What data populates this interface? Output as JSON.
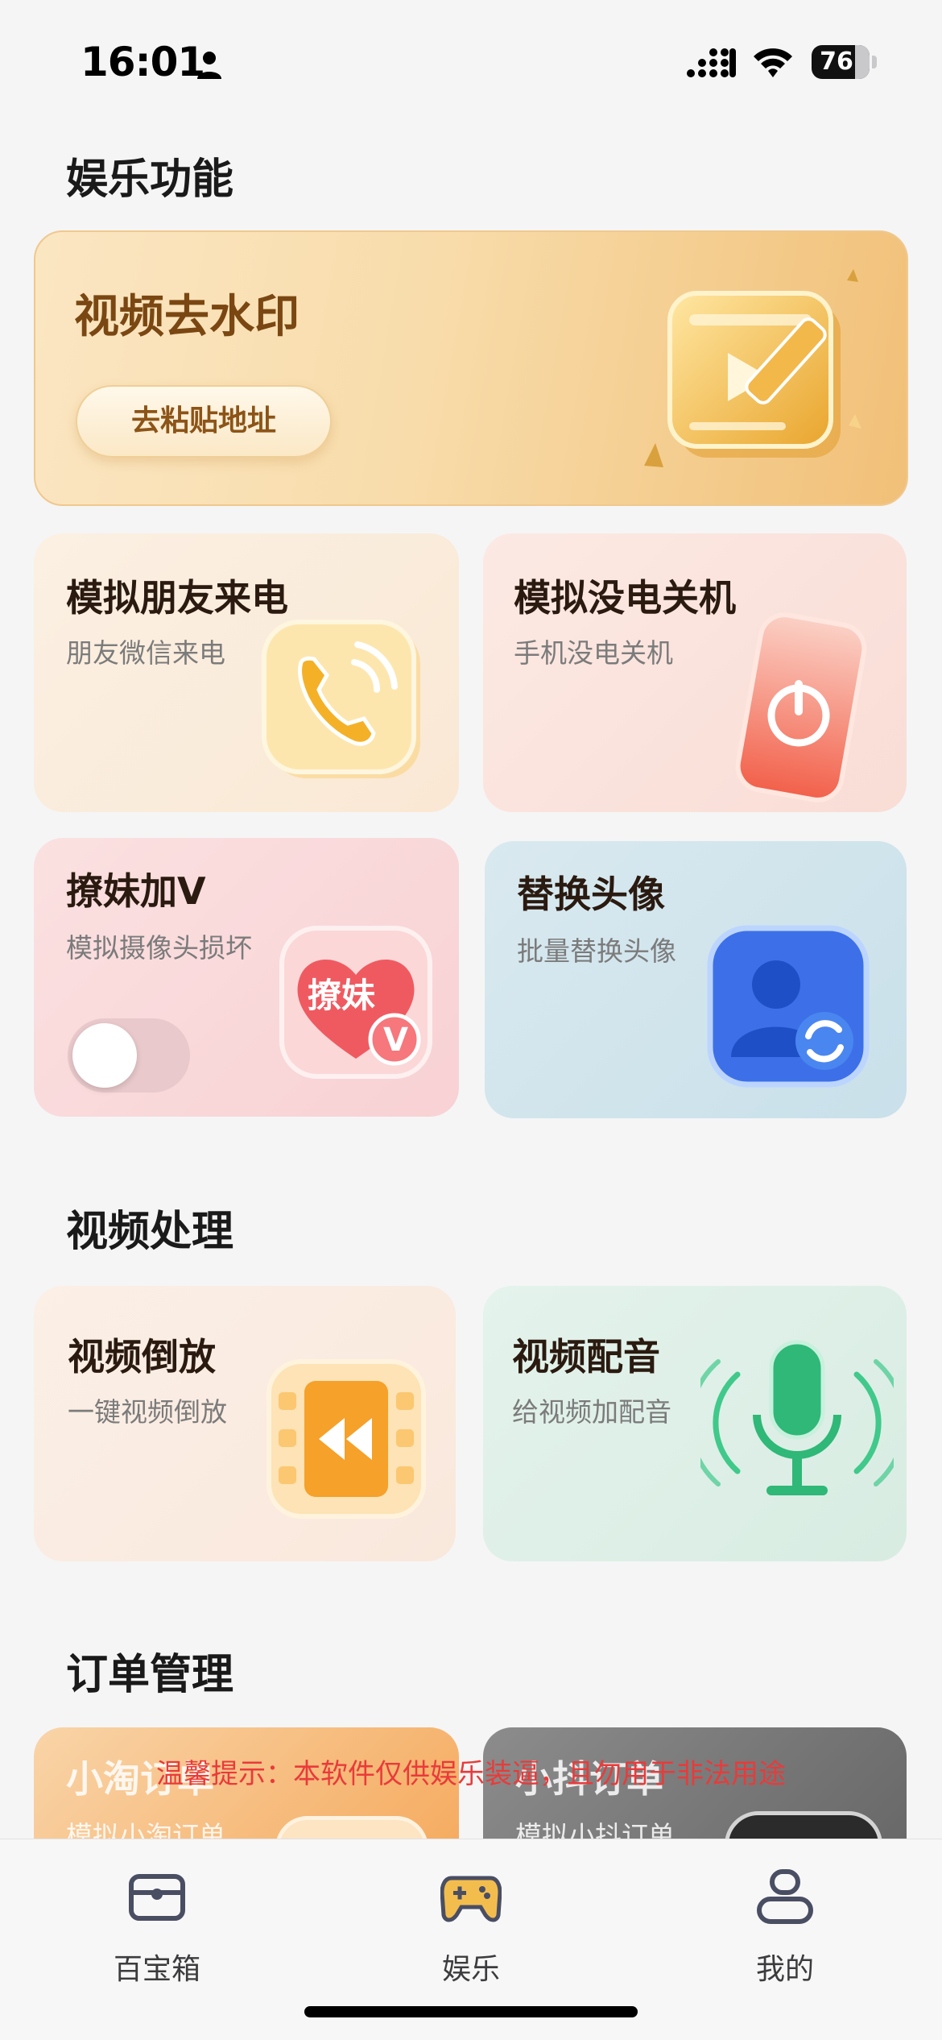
{
  "status_bar": {
    "time": "16:01",
    "battery": "76"
  },
  "sections": {
    "entertainment": "娱乐功能",
    "video": "视频处理",
    "orders": "订单管理"
  },
  "hero": {
    "title": "视频去水印",
    "button": "去粘贴地址",
    "icon": "video-watermark-icon"
  },
  "cards": {
    "call": {
      "title": "模拟朋友来电",
      "subtitle": "朋友微信来电",
      "icon": "phone-call-icon"
    },
    "power": {
      "title": "模拟没电关机",
      "subtitle": "手机没电关机",
      "icon": "power-off-phone-icon"
    },
    "girl": {
      "title": "撩妹加V",
      "subtitle": "模拟摄像头损坏",
      "badge": "撩妹",
      "badge_v": "V",
      "toggle_on": false,
      "icon": "heart-v-icon"
    },
    "avatar": {
      "title": "替换头像",
      "subtitle": "批量替换头像",
      "icon": "avatar-swap-icon"
    },
    "reverse": {
      "title": "视频倒放",
      "subtitle": "一键视频倒放",
      "icon": "rewind-film-icon"
    },
    "dub": {
      "title": "视频配音",
      "subtitle": "给视频加配音",
      "icon": "microphone-icon"
    },
    "taobao": {
      "title": "小淘订单",
      "subtitle": "模拟小淘订单"
    },
    "douyin": {
      "title": "小抖订单",
      "subtitle": "模拟小抖订单"
    }
  },
  "warning": "温馨提示：本软件仅供娱乐装逼，且勿用于非法用途",
  "tab_bar": {
    "items": [
      {
        "label": "百宝箱",
        "icon": "toolbox-icon"
      },
      {
        "label": "娱乐",
        "icon": "gamepad-icon",
        "active": true
      },
      {
        "label": "我的",
        "icon": "user-icon"
      }
    ]
  },
  "colors": {
    "accent": "#f2b84b",
    "warning": "#ea3a3a",
    "background": "#f5f5f6"
  }
}
